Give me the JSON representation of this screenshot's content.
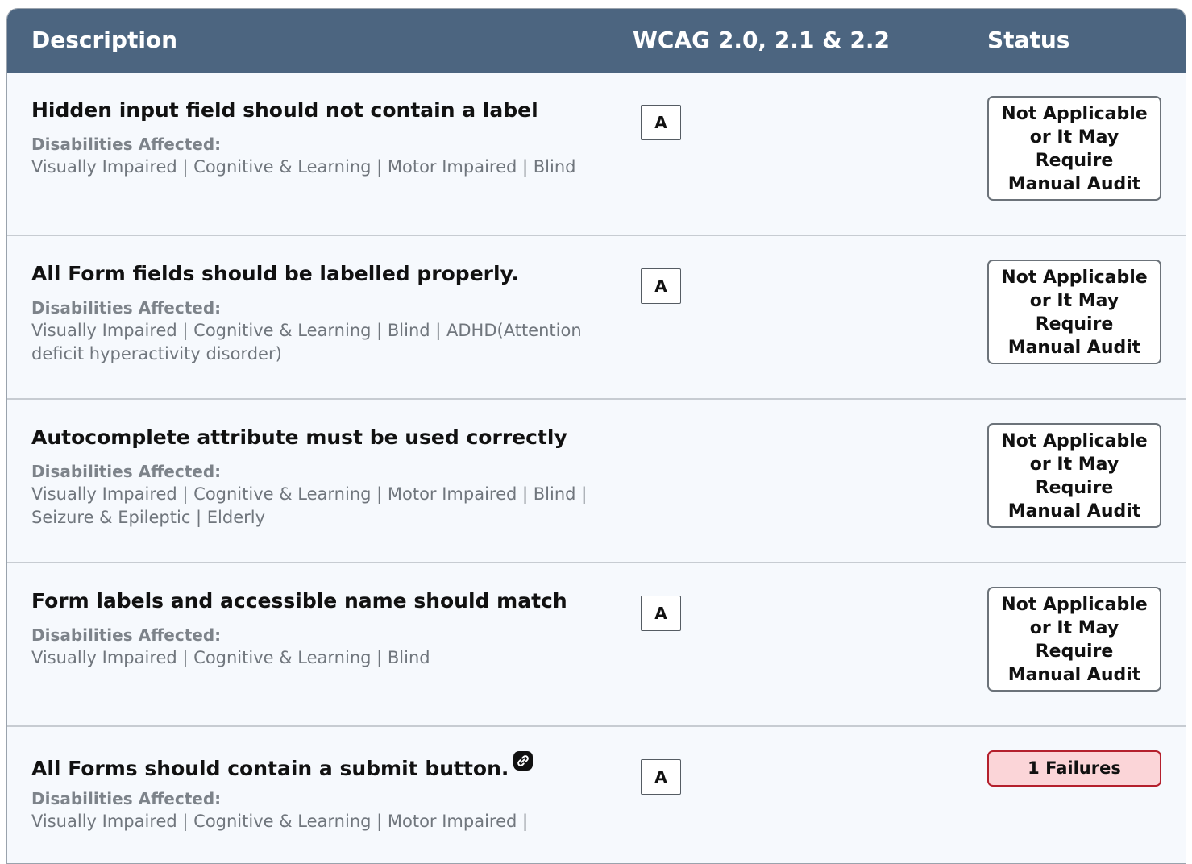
{
  "header": {
    "description": "Description",
    "wcag": "WCAG 2.0, 2.1 & 2.2",
    "status": "Status"
  },
  "rows": [
    {
      "title": "Hidden input field should not contain a label",
      "disabilities_label": "Disabilities Affected:",
      "disabilities": "Visually Impaired | Cognitive & Learning | Motor Impaired | Blind",
      "level": "A",
      "status": "Not Applicable or It May Require Manual Audit"
    },
    {
      "title": "All Form fields should be labelled properly.",
      "disabilities_label": "Disabilities Affected:",
      "disabilities": "Visually Impaired | Cognitive & Learning | Blind | ADHD(Attention deficit hyperactivity disorder)",
      "level": "A",
      "status": "Not Applicable or It May Require Manual Audit"
    },
    {
      "title": "Autocomplete attribute must be used correctly",
      "disabilities_label": "Disabilities Affected:",
      "disabilities": "Visually Impaired | Cognitive & Learning | Motor Impaired | Blind | Seizure & Epileptic | Elderly",
      "level": "",
      "status": "Not Applicable or It May Require Manual Audit"
    },
    {
      "title": "Form labels and accessible name should match",
      "disabilities_label": "Disabilities Affected:",
      "disabilities": "Visually Impaired | Cognitive & Learning | Blind",
      "level": "A",
      "status": "Not Applicable or It May Require Manual Audit"
    },
    {
      "title": "All Forms should contain a submit button.",
      "title_icon": "link-icon",
      "disabilities_label": "Disabilities Affected:",
      "disabilities": "Visually Impaired | Cognitive & Learning | Motor Impaired |",
      "level": "A",
      "status": "1 Failures"
    }
  ],
  "colors": {
    "header_bg": "#4c6580",
    "row_bg": "#f6f9fd",
    "fail_bg": "#fbd5d8",
    "fail_border": "#b4202d"
  }
}
